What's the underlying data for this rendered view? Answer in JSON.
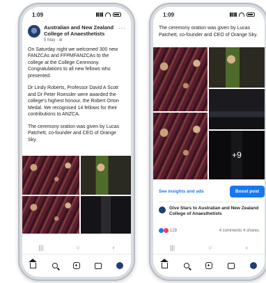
{
  "left_phone": {
    "status_time": "1:09",
    "post": {
      "org_name": "Australian and New Zealand College of Anaesthetists",
      "date": "5 May · ⊕",
      "more": "···",
      "paragraphs": [
        "On Saturday night we welcomed 300 new FANZCAs and FFPMFANZCAs to the college at the College Ceremony. Congratulations to all new fellows who presented.",
        "Dr Lindy Roberts, Professor David A Scott and Dr Peter Roessler were awarded the college's highest honour, the Robert Orton Medal. We recognised 14 fellows for their contributions to ANZCA.",
        "The ceremony oration was given by Lucas Patchett, co-founder and CEO of Orange Sky."
      ]
    },
    "nav": {
      "menu": "|||",
      "home": "○",
      "back": "‹"
    }
  },
  "right_phone": {
    "status_time": "1:09",
    "post_text": "The ceremony oration was given by Lucas Patchett, co-founder and CEO of Orange Sky.",
    "more_photos": "+9",
    "insights_label": "See insights and ads",
    "boost_label": "Boost post",
    "stars_text": "Give Stars to Australian and New Zealand College of Anaesthetists",
    "reaction_count": "129",
    "comments_shares": "4 comments  4 shares",
    "nav": {
      "menu": "|||",
      "home": "○",
      "back": "‹"
    }
  },
  "icons": [
    "home-icon",
    "search-icon",
    "create-icon",
    "marketplace-icon",
    "profile-icon"
  ],
  "colors": {
    "facebook_blue": "#1877f2",
    "text": "#1c1e21",
    "muted": "#65676b"
  }
}
